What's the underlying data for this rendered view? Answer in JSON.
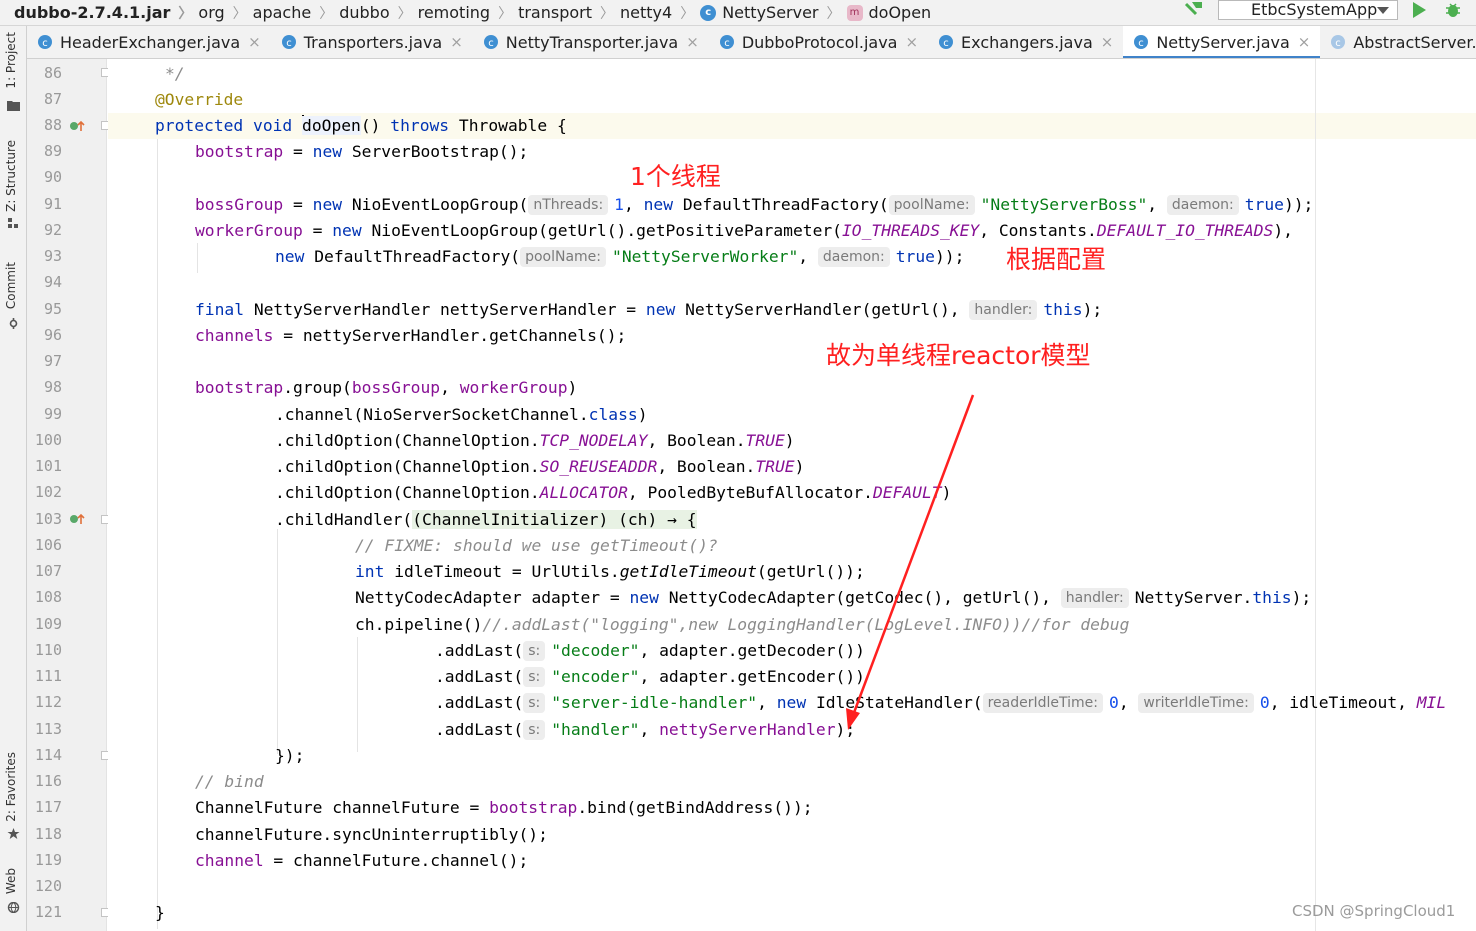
{
  "breadcrumb": {
    "items": [
      "dubbo-2.7.4.1.jar",
      "org",
      "apache",
      "dubbo",
      "remoting",
      "transport",
      "netty4",
      "NettyServer",
      "doOpen"
    ],
    "class_badge": "c",
    "method_badge": "m"
  },
  "toolbar": {
    "run_config": "EtbcSystemApp",
    "build_icon": "hammer-icon",
    "run_icon": "play-icon",
    "debug_icon": "bug-icon"
  },
  "tool_windows": [
    {
      "label": "1: Project",
      "icon": "folder-icon"
    },
    {
      "label": "Z: Structure",
      "icon": "structure-icon"
    },
    {
      "label": "Commit",
      "icon": "commit-icon"
    },
    {
      "label": "2: Favorites",
      "icon": "star-icon"
    },
    {
      "label": "Web",
      "icon": "globe-icon"
    }
  ],
  "tabs": [
    {
      "label": "HeaderExchanger.java",
      "active": false
    },
    {
      "label": "Transporters.java",
      "active": false
    },
    {
      "label": "NettyTransporter.java",
      "active": false
    },
    {
      "label": "DubboProtocol.java",
      "active": false
    },
    {
      "label": "Exchangers.java",
      "active": false
    },
    {
      "label": "NettyServer.java",
      "active": true
    },
    {
      "label": "AbstractServer.java",
      "active": false
    },
    {
      "label": "A",
      "active": false
    }
  ],
  "tab_close_glyph": "×",
  "line_numbers": [
    "86",
    "87",
    "88",
    "89",
    "90",
    "91",
    "92",
    "93",
    "94",
    "95",
    "96",
    "97",
    "98",
    "99",
    "100",
    "101",
    "102",
    "103",
    "106",
    "107",
    "108",
    "109",
    "110",
    "111",
    "112",
    "113",
    "114",
    "116",
    "117",
    "118",
    "119",
    "120",
    "121"
  ],
  "code": {
    "l86": "*/",
    "l87": "@Override",
    "l88_kw": "protected void ",
    "l88_name": "doOpen",
    "l88_mid": "() ",
    "l88_throws": "throws",
    "l88_tail": " Throwable {",
    "l89_f": "bootstrap",
    "l89_a": " = ",
    "l89_kw": "new",
    "l89_b": " ServerBootstrap();",
    "l91_f": "bossGroup",
    "l91_a": " = ",
    "l91_kw": "new",
    "l91_b": " NioEventLoopGroup(",
    "l91_h1": "nThreads:",
    "l91_n": "1",
    "l91_c": ", ",
    "l91_kw2": "new",
    "l91_d": " DefaultThreadFactory(",
    "l91_h2": "poolName:",
    "l91_s": "\"NettyServerBoss\"",
    "l91_e": ", ",
    "l91_h3": "daemon:",
    "l91_t": "true",
    "l91_f2": "));",
    "l92_f": "workerGroup",
    "l92_a": " = ",
    "l92_kw": "new",
    "l92_b": " NioEventLoopGroup(getUrl().getPositiveParameter(",
    "l92_c1": "IO_THREADS_KEY",
    "l92_c": ", Constants.",
    "l92_c2": "DEFAULT_IO_THREADS",
    "l92_d": "),",
    "l93_kw": "new",
    "l93_a": " DefaultThreadFactory(",
    "l93_h1": "poolName:",
    "l93_s": "\"NettyServerWorker\"",
    "l93_b": ", ",
    "l93_h2": "daemon:",
    "l93_t": "true",
    "l93_c": "));",
    "l95_kw": "final",
    "l95_a": " NettyServerHandler nettyServerHandler = ",
    "l95_kw2": "new",
    "l95_b": " NettyServerHandler(getUrl(), ",
    "l95_h": "handler:",
    "l95_this": "this",
    "l95_c": ");",
    "l96_f": "channels",
    "l96_a": " = nettyServerHandler.getChannels();",
    "l98_f": "bootstrap",
    "l98_a": ".group(",
    "l98_f2": "bossGroup",
    "l98_b": ", ",
    "l98_f3": "workerGroup",
    "l98_c": ")",
    "l99_a": ".channel(NioServerSocketChannel.",
    "l99_kw": "class",
    "l99_b": ")",
    "l100_a": ".childOption(ChannelOption.",
    "l100_c": "TCP_NODELAY",
    "l100_b": ", Boolean.",
    "l100_t": "TRUE",
    "l100_d": ")",
    "l101_a": ".childOption(ChannelOption.",
    "l101_c": "SO_REUSEADDR",
    "l101_b": ", Boolean.",
    "l101_t": "TRUE",
    "l101_d": ")",
    "l102_a": ".childOption(ChannelOption.",
    "l102_c": "ALLOCATOR",
    "l102_b": ", PooledByteBufAllocator.",
    "l102_t": "DEFAULT",
    "l102_d": ")",
    "l103_a": ".childHandler(",
    "l103_l": "(ChannelInitializer) (ch) → {",
    "l106": "// FIXME: should we use getTimeout()?",
    "l107_kw": "int",
    "l107_a": " idleTimeout = UrlUtils.",
    "l107_m": "getIdleTimeout",
    "l107_b": "(getUrl());",
    "l108_a": "NettyCodecAdapter adapter = ",
    "l108_kw": "new",
    "l108_b": " NettyCodecAdapter(getCodec(), getUrl(), ",
    "l108_h": "handler:",
    "l108_c": "NettyServer.",
    "l108_this": "this",
    "l108_d": ");",
    "l109_a": "ch.pipeline()",
    "l109_cmt": "//.addLast(\"logging\",new LoggingHandler(LogLevel.INFO))//for debug",
    "l110_a": ".addLast(",
    "l110_h": "s:",
    "l110_s": "\"decoder\"",
    "l110_b": ", adapter.getDecoder())",
    "l111_a": ".addLast(",
    "l111_h": "s:",
    "l111_s": "\"encoder\"",
    "l111_b": ", adapter.getEncoder())",
    "l112_a": ".addLast(",
    "l112_h": "s:",
    "l112_s": "\"server-idle-handler\"",
    "l112_b": ", ",
    "l112_kw": "new",
    "l112_c": " IdleStateHandler(",
    "l112_h2": "readerIdleTime:",
    "l112_n1": "0",
    "l112_d": ", ",
    "l112_h3": "writerIdleTime:",
    "l112_n2": "0",
    "l112_e": ", idleTimeout, ",
    "l112_mil": "MIL",
    "l113_a": ".addLast(",
    "l113_h": "s:",
    "l113_s": "\"handler\"",
    "l113_b": ", ",
    "l113_f": "nettyServerHandler",
    "l113_c": ");",
    "l114": "});",
    "l116": "// bind",
    "l117_a": "ChannelFuture channelFuture = ",
    "l117_f": "bootstrap",
    "l117_b": ".bind(getBindAddress());",
    "l118": "channelFuture.syncUninterruptibly();",
    "l119_f": "channel",
    "l119_a": " = channelFuture.channel();",
    "l121": "}"
  },
  "annotations": {
    "one_thread": "1个线程",
    "by_config": "根据配置",
    "reactor": "故为单线程reactor模型",
    "color": "#ff2020"
  },
  "watermark": "CSDN @SpringCloud1"
}
